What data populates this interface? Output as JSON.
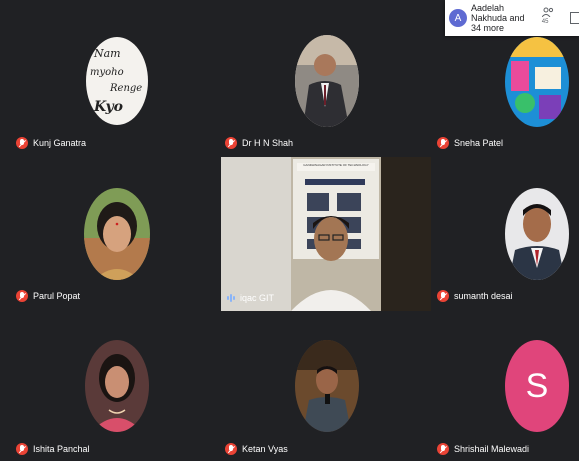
{
  "header": {
    "avatar_letter": "A",
    "participants_text": "Aadelah Nakhuda and 34 more",
    "people_icon": "people-icon",
    "people_count": "45",
    "chat_icon": "chat-icon"
  },
  "tiles": {
    "kunj": {
      "name": "Kunj Ganatra",
      "avatar_text": "Nam Myoho Renge Kyo"
    },
    "hn_shah": {
      "name": "Dr H N Shah"
    },
    "sneha": {
      "name": "Sneha Patel"
    },
    "parul": {
      "name": "Parul Popat"
    },
    "iqac": {
      "name": "iqac GIT",
      "poster_title": "GANDHINAGAR INSTITUTE OF TECHNOLOGY"
    },
    "sumanth": {
      "name": "sumanth desai"
    },
    "ishita": {
      "name": "Ishita Panchal"
    },
    "ketan": {
      "name": "Ketan Vyas"
    },
    "shrishail": {
      "name": "Shrishail Malewadi",
      "avatar_letter": "S"
    }
  },
  "colors": {
    "background": "#202124",
    "muted_red": "#ea4335",
    "avatar_pink": "#e0457b"
  }
}
